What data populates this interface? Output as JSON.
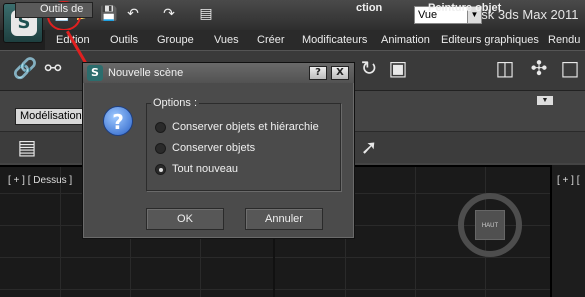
{
  "app": {
    "title": "Autodesk 3ds Max  2011",
    "logo_glyph": "S"
  },
  "quick_access": {
    "icons": [
      "new-scene-icon",
      "open-file-icon",
      "save-icon",
      "undo-icon",
      "redo-icon",
      "project-folder-icon"
    ]
  },
  "menu": {
    "items": [
      "Edition",
      "Outils",
      "Groupe",
      "Vues",
      "Créer",
      "Modificateurs",
      "Animation",
      "Editeurs graphiques",
      "Rendu"
    ]
  },
  "toolbar": {
    "view_select_value": "Vue",
    "icons": [
      "link-icon",
      "unlink-icon",
      "bind-icon",
      "rotate-icon",
      "select-region-icon",
      "pivot-icon"
    ]
  },
  "ribbon": {
    "tab_outils": "Outils de",
    "tab_partial": "ction",
    "tab_peinture": "Peinture objet",
    "tab_modelisation": "Modélisation"
  },
  "viewport": {
    "label": "[ + ] [ Dessus ]",
    "right_label": "[ + ] [",
    "viewcube_label": "HAUT"
  },
  "dialog": {
    "title": "Nouvelle scène",
    "help_button": "?",
    "close_button": "X",
    "options_label": "Options :",
    "options": [
      {
        "label": "Conserver objets et hiérarchie",
        "checked": false
      },
      {
        "label": "Conserver objets",
        "checked": false
      },
      {
        "label": "Tout nouveau",
        "checked": true
      }
    ],
    "ok_label": "OK",
    "cancel_label": "Annuler"
  },
  "colors": {
    "annotation": "#e02020",
    "app_accent": "#2c6d6d"
  }
}
